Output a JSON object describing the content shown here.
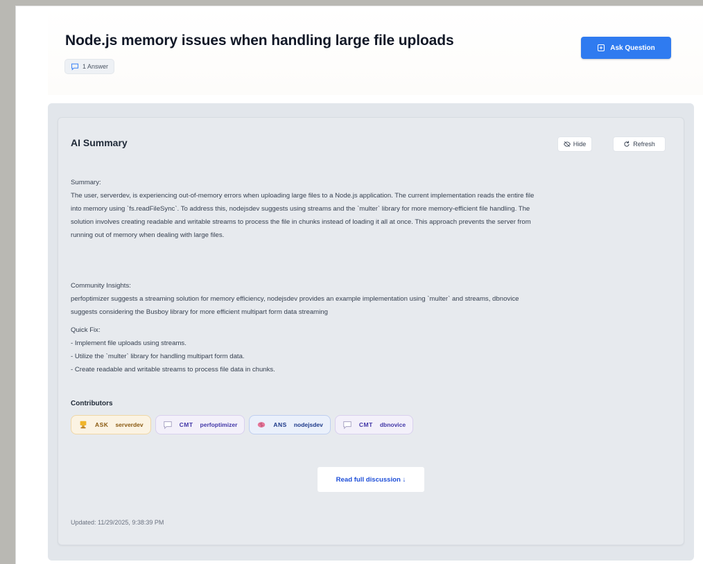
{
  "header": {
    "title": "Node.js memory issues when handling large file uploads",
    "answers_badge": "1 Answer",
    "ask_button": "Ask Question"
  },
  "summary_card": {
    "title": "AI Summary",
    "hide_label": "Hide",
    "refresh_label": "Refresh",
    "summary_heading": "Summary:",
    "summary_lines": [
      "The user, serverdev, is experiencing out-of-memory errors when uploading large files to a Node.js application. The current implementation reads the entire file",
      "into memory using `fs.readFileSync`. To address this, nodejsdev suggests using streams and the `multer` library for more memory-efficient file handling. The",
      "solution involves creating readable and writable streams to process the file in chunks instead of loading it all at once. This approach prevents the server from",
      "running out of memory when dealing with large files."
    ],
    "insights_heading": "Community Insights:",
    "insights_lines": [
      "perfoptimizer suggests a streaming solution for memory efficiency, nodejsdev provides an example implementation using `multer` and streams, dbnovice",
      "suggests considering the Busboy library for more efficient multipart form data streaming"
    ],
    "quickfix_heading": "Quick Fix:",
    "quickfix_lines": [
      "- Implement file uploads using streams.",
      "- Utilize the `multer` library for handling multipart form data.",
      "- Create readable and writable streams to process file data in chunks."
    ],
    "contributors_heading": "Contributors",
    "contributors": [
      {
        "role": "ASK",
        "name": "serverdev",
        "kind": "ask"
      },
      {
        "role": "CMT",
        "name": "perfoptimizer",
        "kind": "cmt"
      },
      {
        "role": "ANS",
        "name": "nodejsdev",
        "kind": "ans"
      },
      {
        "role": "CMT",
        "name": "dbnovice",
        "kind": "cmt"
      }
    ],
    "read_full": "Read full discussion ↓",
    "updated": "Updated: 11/29/2025, 9:38:39 PM"
  },
  "colors": {
    "primary": "#2f7bf0",
    "ask_chip": "#fbf3e3",
    "cmt_chip": "#f3f0fa",
    "ans_chip": "#eaf0fb"
  },
  "icons": [
    "comment-icon",
    "plus-square-icon",
    "eye-off-icon",
    "refresh-icon",
    "trophy-icon",
    "speech-bubble-icon",
    "brain-icon"
  ]
}
